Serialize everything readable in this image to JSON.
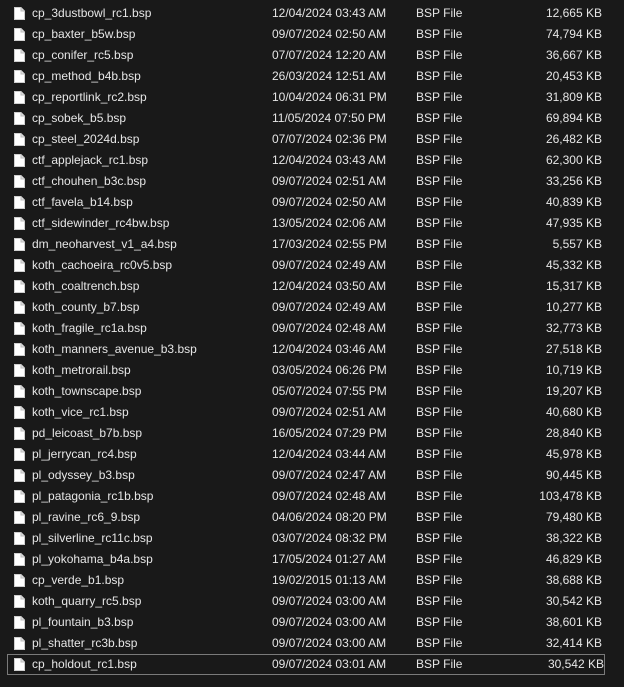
{
  "files": [
    {
      "name": "cp_3dustbowl_rc1.bsp",
      "date": "12/04/2024 03:43 AM",
      "type": "BSP File",
      "size": "12,665 KB"
    },
    {
      "name": "cp_baxter_b5w.bsp",
      "date": "09/07/2024 02:50 AM",
      "type": "BSP File",
      "size": "74,794 KB"
    },
    {
      "name": "cp_conifer_rc5.bsp",
      "date": "07/07/2024 12:20 AM",
      "type": "BSP File",
      "size": "36,667 KB"
    },
    {
      "name": "cp_method_b4b.bsp",
      "date": "26/03/2024 12:51 AM",
      "type": "BSP File",
      "size": "20,453 KB"
    },
    {
      "name": "cp_reportlink_rc2.bsp",
      "date": "10/04/2024 06:31 PM",
      "type": "BSP File",
      "size": "31,809 KB"
    },
    {
      "name": "cp_sobek_b5.bsp",
      "date": "11/05/2024 07:50 PM",
      "type": "BSP File",
      "size": "69,894 KB"
    },
    {
      "name": "cp_steel_2024d.bsp",
      "date": "07/07/2024 02:36 PM",
      "type": "BSP File",
      "size": "26,482 KB"
    },
    {
      "name": "ctf_applejack_rc1.bsp",
      "date": "12/04/2024 03:43 AM",
      "type": "BSP File",
      "size": "62,300 KB"
    },
    {
      "name": "ctf_chouhen_b3c.bsp",
      "date": "09/07/2024 02:51 AM",
      "type": "BSP File",
      "size": "33,256 KB"
    },
    {
      "name": "ctf_favela_b14.bsp",
      "date": "09/07/2024 02:50 AM",
      "type": "BSP File",
      "size": "40,839 KB"
    },
    {
      "name": "ctf_sidewinder_rc4bw.bsp",
      "date": "13/05/2024 02:06 AM",
      "type": "BSP File",
      "size": "47,935 KB"
    },
    {
      "name": "dm_neoharvest_v1_a4.bsp",
      "date": "17/03/2024 02:55 PM",
      "type": "BSP File",
      "size": "5,557 KB"
    },
    {
      "name": "koth_cachoeira_rc0v5.bsp",
      "date": "09/07/2024 02:49 AM",
      "type": "BSP File",
      "size": "45,332 KB"
    },
    {
      "name": "koth_coaltrench.bsp",
      "date": "12/04/2024 03:50 AM",
      "type": "BSP File",
      "size": "15,317 KB"
    },
    {
      "name": "koth_county_b7.bsp",
      "date": "09/07/2024 02:49 AM",
      "type": "BSP File",
      "size": "10,277 KB"
    },
    {
      "name": "koth_fragile_rc1a.bsp",
      "date": "09/07/2024 02:48 AM",
      "type": "BSP File",
      "size": "32,773 KB"
    },
    {
      "name": "koth_manners_avenue_b3.bsp",
      "date": "12/04/2024 03:46 AM",
      "type": "BSP File",
      "size": "27,518 KB"
    },
    {
      "name": "koth_metrorail.bsp",
      "date": "03/05/2024 06:26 PM",
      "type": "BSP File",
      "size": "10,719 KB"
    },
    {
      "name": "koth_townscape.bsp",
      "date": "05/07/2024 07:55 PM",
      "type": "BSP File",
      "size": "19,207 KB"
    },
    {
      "name": "koth_vice_rc1.bsp",
      "date": "09/07/2024 02:51 AM",
      "type": "BSP File",
      "size": "40,680 KB"
    },
    {
      "name": "pd_leicoast_b7b.bsp",
      "date": "16/05/2024 07:29 PM",
      "type": "BSP File",
      "size": "28,840 KB"
    },
    {
      "name": "pl_jerrycan_rc4.bsp",
      "date": "12/04/2024 03:44 AM",
      "type": "BSP File",
      "size": "45,978 KB"
    },
    {
      "name": "pl_odyssey_b3.bsp",
      "date": "09/07/2024 02:47 AM",
      "type": "BSP File",
      "size": "90,445 KB"
    },
    {
      "name": "pl_patagonia_rc1b.bsp",
      "date": "09/07/2024 02:48 AM",
      "type": "BSP File",
      "size": "103,478 KB"
    },
    {
      "name": "pl_ravine_rc6_9.bsp",
      "date": "04/06/2024 08:20 PM",
      "type": "BSP File",
      "size": "79,480 KB"
    },
    {
      "name": "pl_silverline_rc11c.bsp",
      "date": "03/07/2024 08:32 PM",
      "type": "BSP File",
      "size": "38,322 KB"
    },
    {
      "name": "pl_yokohama_b4a.bsp",
      "date": "17/05/2024 01:27 AM",
      "type": "BSP File",
      "size": "46,829 KB"
    },
    {
      "name": "cp_verde_b1.bsp",
      "date": "19/02/2015 01:13 AM",
      "type": "BSP File",
      "size": "38,688 KB"
    },
    {
      "name": "koth_quarry_rc5.bsp",
      "date": "09/07/2024 03:00 AM",
      "type": "BSP File",
      "size": "30,542 KB"
    },
    {
      "name": "pl_fountain_b3.bsp",
      "date": "09/07/2024 03:00 AM",
      "type": "BSP File",
      "size": "38,601 KB"
    },
    {
      "name": "pl_shatter_rc3b.bsp",
      "date": "09/07/2024 03:00 AM",
      "type": "BSP File",
      "size": "32,414 KB"
    },
    {
      "name": "cp_holdout_rc1.bsp",
      "date": "09/07/2024 03:01 AM",
      "type": "BSP File",
      "size": "30,542 KB"
    }
  ],
  "icon": "document-file-icon",
  "colors": {
    "background": "#191919",
    "text": "#e6e6e6",
    "focus_border": "#7a7a7a"
  }
}
